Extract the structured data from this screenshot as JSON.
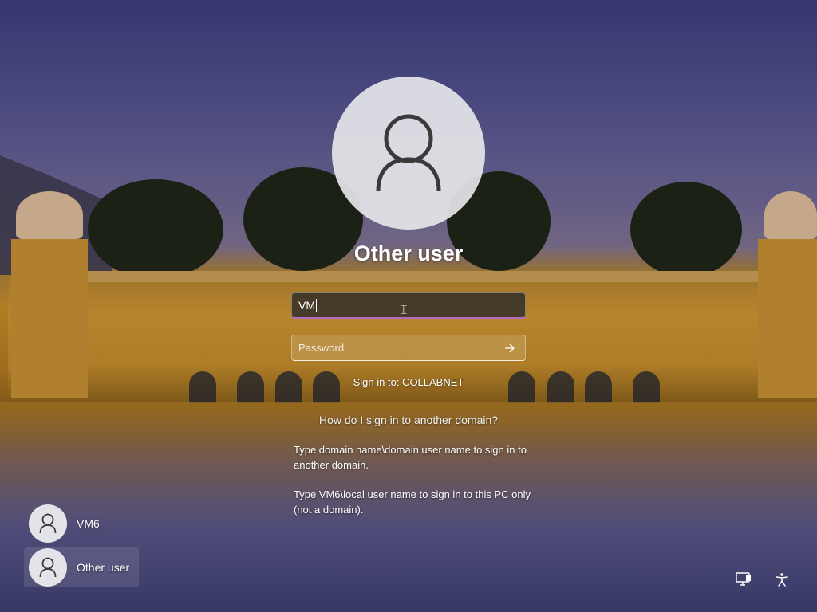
{
  "login": {
    "user_title": "Other user",
    "username_value": "VM",
    "password_placeholder": "Password",
    "sign_in_to": "Sign in to: COLLABNET",
    "help_link": "How do I sign in to another domain?",
    "help_text_1": "Type domain name\\domain user name to sign in to another domain.",
    "help_text_2": "Type VM6\\local user name to sign in to this PC only (not a domain)."
  },
  "user_list": [
    {
      "name": "VM6",
      "icon": "user-avatar-icon"
    },
    {
      "name": "Other user",
      "icon": "user-avatar-icon",
      "selected": true
    }
  ],
  "corner_icons": [
    "network-icon",
    "accessibility-icon"
  ],
  "colors": {
    "accent": "#b06cc7",
    "avatar_bg": "#e4e4e8"
  }
}
